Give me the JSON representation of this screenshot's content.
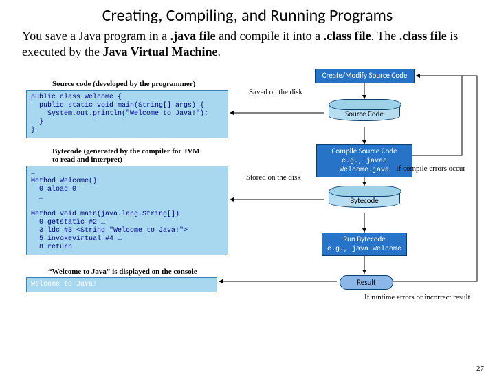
{
  "title": "Creating, Compiling, and Running Programs",
  "intro_parts": {
    "p1": "You save a Java program in a ",
    "b1": ".java file",
    "p2": " and compile it into a ",
    "b2": ".class file",
    "p3": ". The ",
    "b3": ".class file",
    "p4": " is executed by the ",
    "b4": "Java Virtual Machine",
    "p5": "."
  },
  "steps": {
    "create": "Create/Modify Source Code",
    "compile": "Compile Source Code",
    "compile_sub": "e.g., javac Welcome.java",
    "run": "Run Bytecode",
    "run_sub": "e.g., java Welcome"
  },
  "cyls": {
    "source": "Source Code",
    "bytecode": "Bytecode"
  },
  "result": "Result",
  "captions": {
    "source": "Source code (developed by the programmer)",
    "bytecode_l1": "Bytecode (generated by the compiler for JVM",
    "bytecode_l2": "to read and interpret)",
    "output": "“Welcome to Java” is displayed on the console"
  },
  "notes": {
    "saved": "Saved on the disk",
    "stored": "Stored on the disk",
    "compile_err": "If compile errors occur",
    "runtime_err": "If runtime errors or incorrect result"
  },
  "code": {
    "source": "public class Welcome {\n  public static void main(String[] args) {\n    System.out.println(\"Welcome to Java!\");\n  }\n}",
    "bytecode": "…\nMethod Welcome()\n  0 aload_0\n  …\n\nMethod void main(java.lang.String[])\n  0 getstatic #2 …\n  3 ldc #3 <String \"Welcome to Java!\">\n  5 invokevirtual #4 …\n  8 return",
    "output": "Welcome to Java!"
  },
  "page": "27"
}
